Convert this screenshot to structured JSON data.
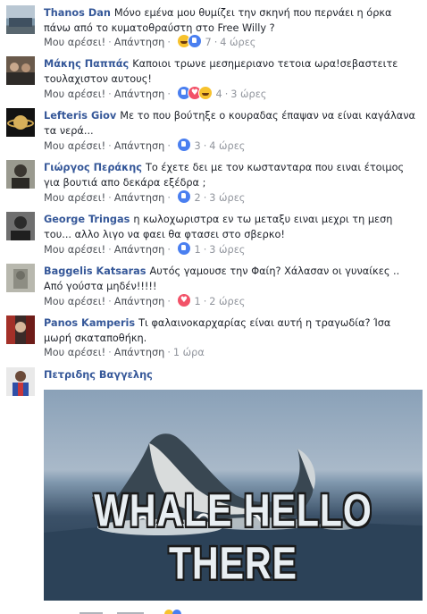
{
  "labels": {
    "like": "Μου αρέσει!",
    "reply": "Απάντηση",
    "dot": "·"
  },
  "colors": {
    "name": "#365899",
    "meta": "#90949c",
    "like_blue": "#4a7ff0",
    "love_red": "#f25268"
  },
  "comments": [
    {
      "author": "Thanos Dan",
      "text": "Μόνο εμένα μου θυμίζει την σκηνή που περνάει η όρκα πάνω από το κυματοθραύστη στο Free Willy ?",
      "reactions": [
        "haha",
        "like"
      ],
      "count": "7",
      "time": "4 ώρες"
    },
    {
      "author": "Μάκης Παππάς",
      "text": "Καποιοι τρωνε μεσημεριανο τετοια ωρα!σεβαστειτε τουλαχιστον αυτους!",
      "reactions": [
        "like",
        "love",
        "haha"
      ],
      "count": "4",
      "time": "3 ώρες"
    },
    {
      "author": "Lefteris Giov",
      "text": "Με το που βούτηξε ο κουραδας έπαψαν να είναι καγάλανα τα νερά...",
      "reactions": [
        "like"
      ],
      "count": "3",
      "time": "4 ώρες"
    },
    {
      "author": "Γιώργος Περάκης",
      "text": "Το έχετε δει με τον κωστανταρα που ειναι έτοιμος για βουτιά απο δεκάρα εξέδρα ;",
      "reactions": [
        "like"
      ],
      "count": "2",
      "time": "3 ώρες"
    },
    {
      "author": "George Tringas",
      "text": "η κωλοχωριστρα εν τω μεταξυ ειναι μεχρι τη μεση του... αλλο λιγο να φαει θα φτασει στο σβερκο!",
      "reactions": [
        "like"
      ],
      "count": "1",
      "time": "3 ώρες"
    },
    {
      "author": "Baggelis Katsaras",
      "text": "Αυτός γαμουσε την Φαίη? Χάλασαν οι γυναίκες .. Από γούστα μηδέν!!!!!",
      "reactions": [
        "love"
      ],
      "count": "1",
      "time": "2 ώρες"
    },
    {
      "author": "Panos Kamperis",
      "text": "Τι φαλαινοκαρχαρίας είναι αυτή η τραγωδία? Ίσα μωρή σκαταποθήκη.",
      "reactions": [],
      "count": "",
      "time": "1 ώρα"
    },
    {
      "author": "Πετριδης Βαγγελης",
      "text": "",
      "gif_caption": "WHALE HELLO THERE"
    }
  ]
}
